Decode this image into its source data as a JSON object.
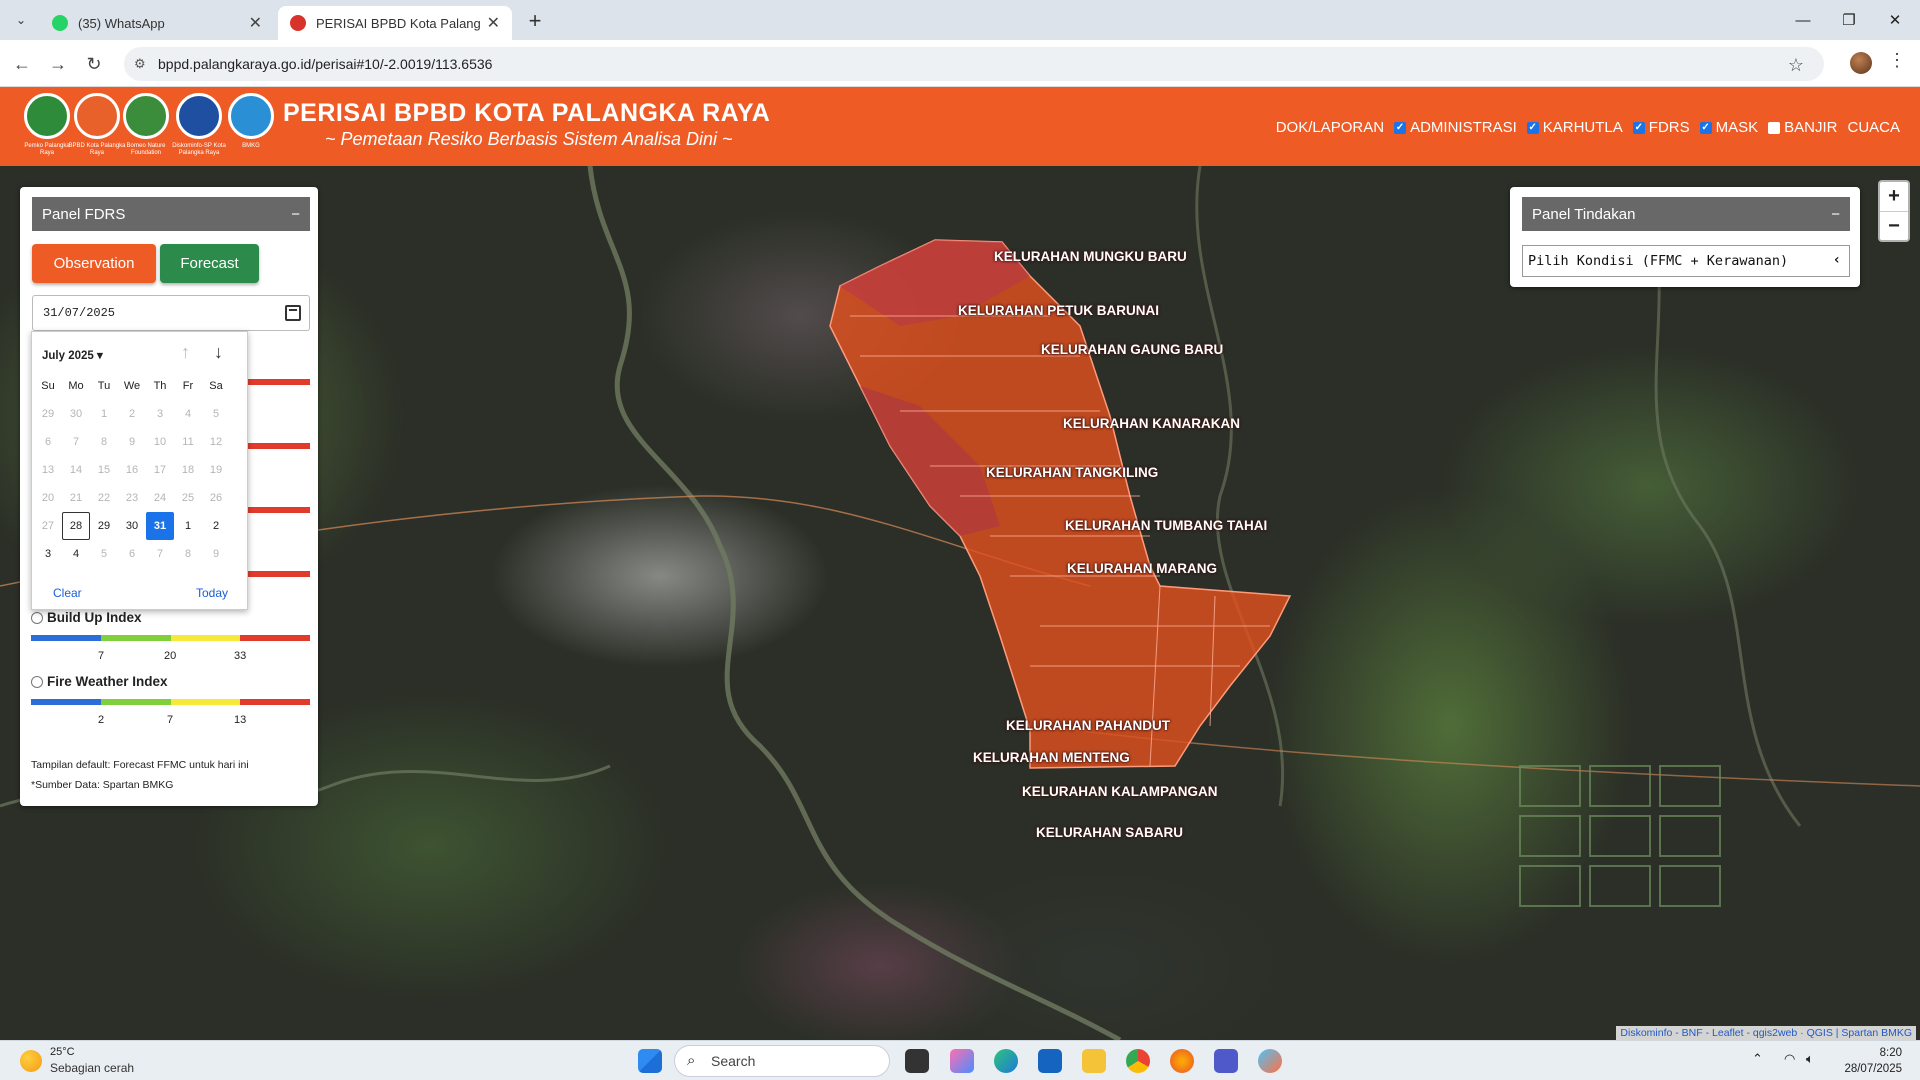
{
  "browser": {
    "tabs": [
      {
        "title": "(35) WhatsApp",
        "icon": "whatsapp-icon",
        "active": false
      },
      {
        "title": "PERISAI BPBD Kota Palangka Raya",
        "icon": "bpbd-favicon",
        "active": true
      }
    ],
    "url": "bppd.palangkaraya.go.id/perisai#10/-2.0019/113.6536"
  },
  "site": {
    "title": "PERISAI BPBD KOTA PALANGKA RAYA",
    "subtitle": "~ Pemetaan Resiko Berbasis Sistem Analisa Dini ~",
    "logos": [
      {
        "caption": "Pemko Palangka Raya",
        "color": "#2e8b3a"
      },
      {
        "caption": "BPBD Kota Palangka Raya",
        "color": "#e8612b"
      },
      {
        "caption": "Borneo Nature Foundation",
        "color": "#3b8c3b"
      },
      {
        "caption": "Diskominfo-SP Kota Palangka Raya",
        "color": "#1f4fa0"
      },
      {
        "caption": "BMKG",
        "color": "#2a8fd4"
      }
    ],
    "nav": [
      {
        "label": "DOK/LAPORAN",
        "checkbox": false,
        "checked": false
      },
      {
        "label": "ADMINISTRASI",
        "checkbox": true,
        "checked": true
      },
      {
        "label": "KARHUTLA",
        "checkbox": true,
        "checked": true
      },
      {
        "label": "FDRS",
        "checkbox": true,
        "checked": true
      },
      {
        "label": "MASK",
        "checkbox": true,
        "checked": true
      },
      {
        "label": "BANJIR",
        "checkbox": true,
        "checked": false
      },
      {
        "label": "CUACA",
        "checkbox": false,
        "checked": false
      }
    ]
  },
  "panel_fdrs": {
    "title": "Panel FDRS",
    "collapse": "−",
    "observation_label": "Observation",
    "forecast_label": "Forecast",
    "date_value": "31/07/2025",
    "datepicker": {
      "month": "July 2025",
      "weekdays": [
        "Su",
        "Mo",
        "Tu",
        "We",
        "Th",
        "Fr",
        "Sa"
      ],
      "weeks": [
        [
          "29",
          "30",
          "1",
          "2",
          "3",
          "4",
          "5"
        ],
        [
          "6",
          "7",
          "8",
          "9",
          "10",
          "11",
          "12"
        ],
        [
          "13",
          "14",
          "15",
          "16",
          "17",
          "18",
          "19"
        ],
        [
          "20",
          "21",
          "22",
          "23",
          "24",
          "25",
          "26"
        ],
        [
          "27",
          "28",
          "29",
          "30",
          "31",
          "1",
          "2"
        ],
        [
          "3",
          "4",
          "5",
          "6",
          "7",
          "8",
          "9"
        ]
      ],
      "today_day": "28",
      "selected_day": "31",
      "clear_label": "Clear",
      "today_label": "Today"
    },
    "indices": [
      {
        "name": "Build Up Index",
        "ticks": [
          "7",
          "20",
          "33"
        ]
      },
      {
        "name": "Fire Weather Index",
        "ticks": [
          "2",
          "7",
          "13"
        ]
      }
    ],
    "scale_colors": [
      "#2b6fd6",
      "#7fd03a",
      "#f6e93a",
      "#e23b2b"
    ],
    "note1": "Tampilan default: Forecast FFMC untuk hari ini",
    "note2": "*Sumber Data: Spartan BMKG"
  },
  "panel_tindakan": {
    "title": "Panel Tindakan",
    "collapse": "−",
    "select_value": "Pilih Kondisi (FFMC + Kerawanan)"
  },
  "map": {
    "zoom_in": "+",
    "zoom_out": "−",
    "labels": [
      "KELURAHAN MUNGKU BARU",
      "KELURAHAN PETUK BARUNAI",
      "KELURAHAN GAUNG BARU",
      "KELURAHAN KANARAKAN",
      "KELURAHAN TANGKILING",
      "KELURAHAN TUMBANG TAHAI",
      "KELURAHAN MARANG",
      "KELURAHAN PAHANDUT",
      "KELURAHAN MENTENG",
      "KELURAHAN KALAMPANGAN",
      "KELURAHAN SABARU"
    ],
    "attribution": "Diskominfo - BNF - Leaflet - qgis2web · QGIS | Spartan BMKG"
  },
  "taskbar": {
    "temperature": "25°C",
    "weather": "Sebagian cerah",
    "search_placeholder": "Search",
    "time": "8:20",
    "date": "28/07/2025"
  }
}
